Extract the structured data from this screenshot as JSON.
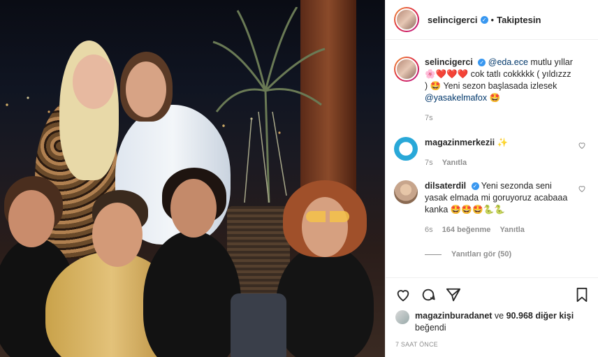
{
  "post": {
    "username": "selincigerci",
    "follow_status": "Takiptesin",
    "separator": "•"
  },
  "caption": {
    "username": "selincigerci",
    "mention1": "@eda.ece",
    "text1": "mutlu yıllar",
    "emojis1": "🌸❤️❤️❤️",
    "text2": "cok tatlı cokkkkk ( yıldızzz )",
    "emoji2": "🤩",
    "text3": "Yeni sezon başlasada izlesek",
    "mention2": "@yasakelmafox",
    "emoji3": "🤩",
    "age": "7s"
  },
  "comments": [
    {
      "username": "magazinmerkezii",
      "text": "",
      "emoji": "✨",
      "age": "7s",
      "reply": "Yanıtla",
      "avatar_color": "#29a8d8"
    },
    {
      "username": "dilsaterdil",
      "text": "Yeni sezonda seni yasak elmada mi goruyoruz acabaaa kanka",
      "emoji": "🤩🤩🤩🐍🐍",
      "age": "6s",
      "likes": "164 beğenme",
      "reply": "Yanıtla",
      "avatar_color": "#c7a58c"
    }
  ],
  "view_replies": "Yanıtları gör (50)",
  "liked_by": {
    "user": "magazinburadanet",
    "rest": "ve",
    "count": "90.968 diğer kişi",
    "suffix": "beğendi"
  },
  "timestamp": "7 SAAT ÖNCE",
  "icons": [
    "heart-icon",
    "comment-icon",
    "share-icon",
    "bookmark-icon"
  ],
  "colors": {
    "verified": "#3897f0",
    "mention": "#00376b",
    "muted": "#8e8e8e"
  }
}
